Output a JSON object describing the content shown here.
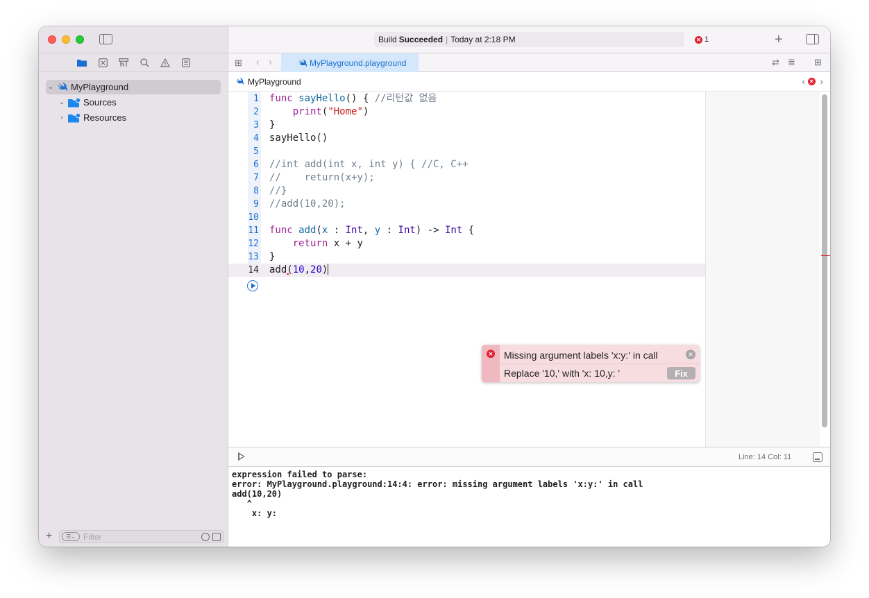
{
  "sidebar": {
    "nav_icons": [
      "folder-icon",
      "source-control-icon",
      "hierarchy-icon",
      "search-icon",
      "warning-icon",
      "report-icon"
    ],
    "tree": [
      {
        "label": "MyPlayground",
        "icon": "swift-icon",
        "expanded": true
      },
      {
        "label": "Sources",
        "icon": "folder-icon",
        "expanded": true
      },
      {
        "label": "Resources",
        "icon": "folder-icon",
        "expanded": false
      }
    ],
    "filter_placeholder": "Filter"
  },
  "toolbar": {
    "activity_prefix": "Build",
    "activity_status": "Succeeded",
    "activity_separator": "|",
    "activity_time": "Today at 2:18 PM",
    "error_count": "1"
  },
  "tabbar": {
    "active_tab": "MyPlayground.playground"
  },
  "jumpbar": {
    "path": "MyPlayground"
  },
  "editor": {
    "lines": [
      {
        "n": "1",
        "text": "func sayHello() { //리턴값 없음"
      },
      {
        "n": "2",
        "text": "    print(\"Home\")"
      },
      {
        "n": "3",
        "text": "}"
      },
      {
        "n": "4",
        "text": "sayHello()"
      },
      {
        "n": "5",
        "text": ""
      },
      {
        "n": "6",
        "text": "//int add(int x, int y) { //C, C++"
      },
      {
        "n": "7",
        "text": "//    return(x+y);"
      },
      {
        "n": "8",
        "text": "//}"
      },
      {
        "n": "9",
        "text": "//add(10,20);"
      },
      {
        "n": "10",
        "text": ""
      },
      {
        "n": "11",
        "text": "func add(x : Int, y : Int) -> Int {"
      },
      {
        "n": "12",
        "text": "    return x + y"
      },
      {
        "n": "13",
        "text": "}"
      },
      {
        "n": "14",
        "text": "add(10,20)"
      }
    ],
    "current_line": 14
  },
  "issue": {
    "message": "Missing argument labels 'x:y:' in call",
    "fix_description": "Replace '10,' with 'x: 10,y: '",
    "fix_label": "Fix"
  },
  "debug": {
    "position": "Line: 14  Col: 11"
  },
  "console": {
    "output": "expression failed to parse:\nerror: MyPlayground.playground:14:4: error: missing argument labels 'x:y:' in call\nadd(10,20)\n   ^\n    x: y:"
  },
  "colors": {
    "accent": "#1b6fd1",
    "error": "#e0212f",
    "sidebar_bg": "#e8e3e8"
  }
}
